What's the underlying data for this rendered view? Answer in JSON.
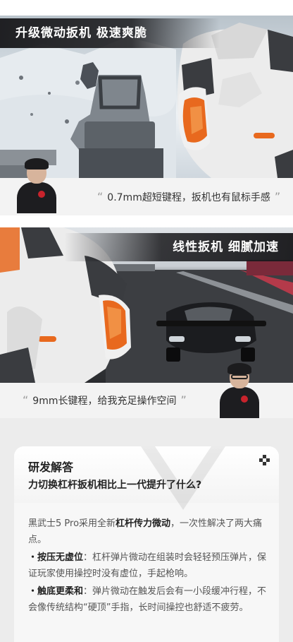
{
  "panel1": {
    "title": "升级微动扳机 极速爽脆",
    "caption": "0.7mm超短键程，扳机也有鼠标手感",
    "quote_open": "“",
    "quote_close": "”"
  },
  "panel2": {
    "title": "线性扳机 细腻加速",
    "caption": "9mm长键程，给我充足操作空间",
    "quote_open": "“",
    "quote_close": "”"
  },
  "faq": {
    "heading": "研发解答",
    "question": "力切换杠杆扳机相比上一代提升了什么?",
    "intro_prefix": "黑武士5 Pro采用全新",
    "intro_highlight": "杠杆传力微动",
    "intro_suffix": "，一次性解决了两大痛点。",
    "point1_label": "・按压无虚位",
    "point1_text": "：杠杆弹片微动在组装时会轻轻预压弹片，保证玩家使用操控时没有虚位，手起枪响。",
    "point2_label": "・触底更柔和",
    "point2_text": "：弹片微动在触发后会有一小段缓冲行程，不会像传统结构“硬顶”手指，长时间操控也舒适不疲劳。"
  },
  "colors": {
    "banner": "#19191c",
    "caption_bg": "#f3f3f3",
    "trigger_orange": "#e8691e",
    "controller_white": "#ececec",
    "card_bg": "#f7f7f7"
  }
}
